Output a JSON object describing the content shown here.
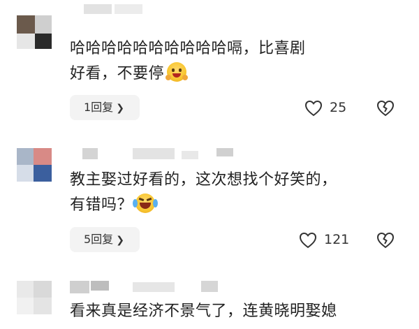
{
  "comments": [
    {
      "text_line1": "哈哈哈哈哈哈哈哈哈哈嗝，比喜剧",
      "text_line2": "好看，不要停",
      "emoji": "grinning-face-hands-emoji",
      "reply_label": "1回复",
      "like_count": "25"
    },
    {
      "text_line1": "教主娶过好看的，这次想找个好笑的，",
      "text_line2": "有错吗？",
      "emoji": "laughing-crying-emoji",
      "reply_label": "5回复",
      "like_count": "121"
    },
    {
      "text_line1": "看来真是经济不景气了，连黄晓明娶媳"
    }
  ],
  "icons": {
    "like": "heart-icon",
    "dislike": "broken-heart-icon",
    "chevron": "chevron-right-icon"
  },
  "colors": {
    "reply_bg": "#f3f3f3",
    "icon_stroke": "#333333",
    "emoji_yellow": "#f8c630"
  }
}
